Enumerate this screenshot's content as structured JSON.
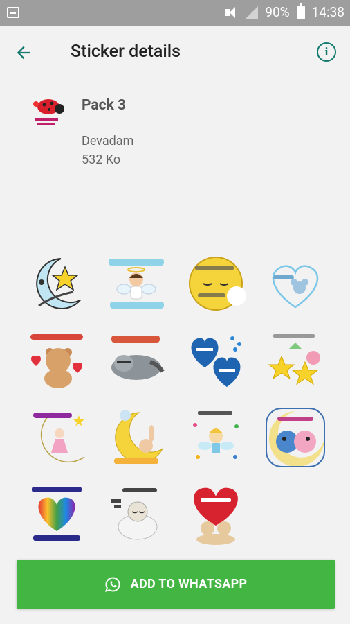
{
  "status_bar": {
    "battery": "90%",
    "time": "14:38"
  },
  "toolbar": {
    "title": "Sticker details"
  },
  "pack": {
    "name": "Pack 3",
    "author": "Devadam",
    "size": "532 Ko"
  },
  "stickers": [
    "buonanotte-moon-star",
    "buonanotte-angel",
    "buonanotte-moon-sleeping",
    "buonanotte-heart-mouse",
    "buona-notte-teddy-bear",
    "buonanotte-raccoon",
    "buona-notte-blue-hearts",
    "buonanotte-stars",
    "buonanotte-girl-moon",
    "buonanotte-rabbit-moon",
    "buonanotte-fairy",
    "buonanotte-birds",
    "buona-notte-ciao-a-domani",
    "buona-notte-sheep",
    "buonanotte-bears-heart"
  ],
  "add_button": {
    "label": "ADD TO WHATSAPP"
  },
  "colors": {
    "accent": "#137a6e",
    "button": "#43b543",
    "status_bar": "#9e9e9e",
    "background": "#f2f2f2"
  }
}
